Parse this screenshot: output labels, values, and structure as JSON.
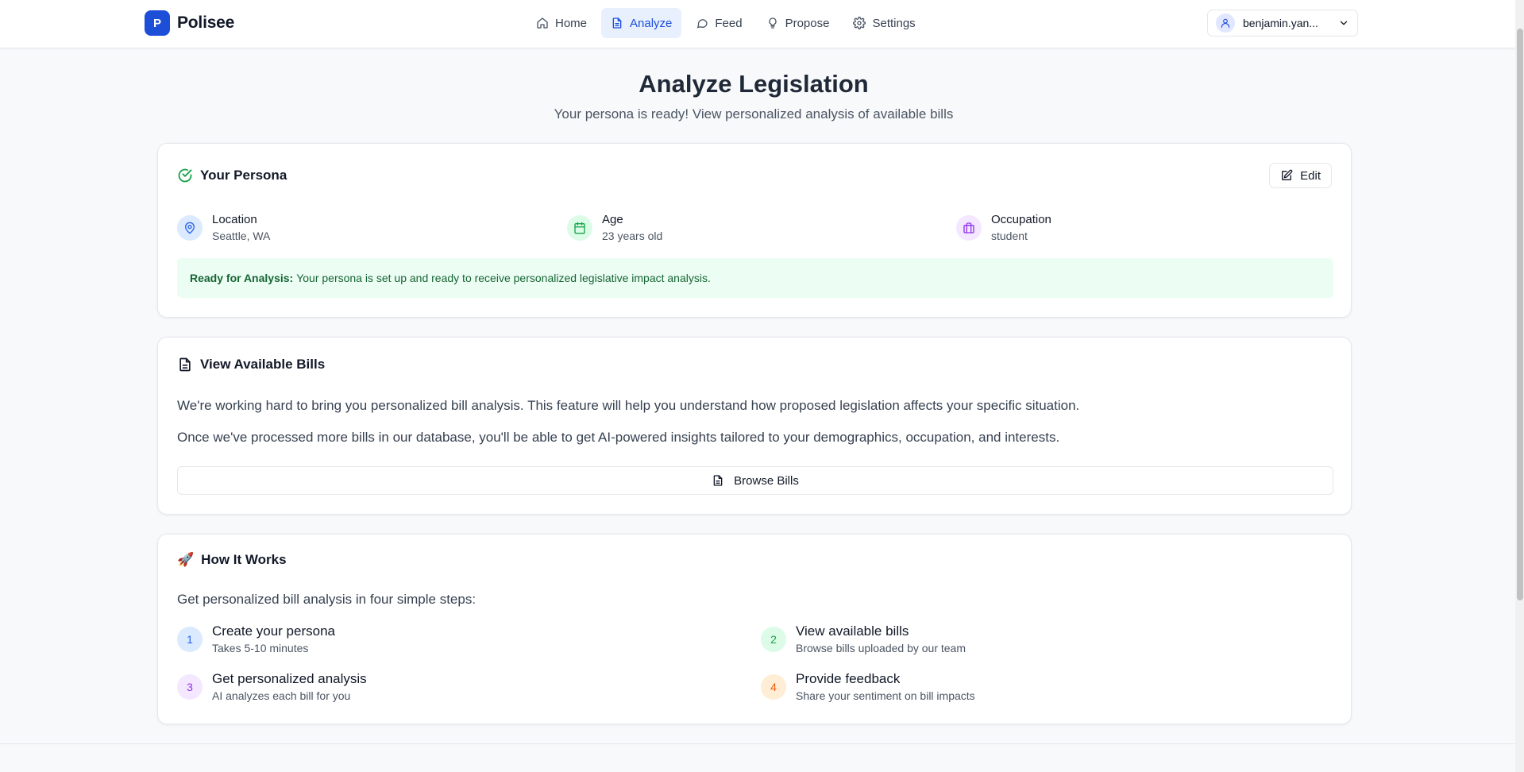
{
  "header": {
    "brand_initial": "P",
    "brand_name": "Polisee",
    "nav": [
      {
        "label": "Home",
        "icon": "home-icon"
      },
      {
        "label": "Analyze",
        "icon": "document-icon",
        "active": true
      },
      {
        "label": "Feed",
        "icon": "message-icon"
      },
      {
        "label": "Propose",
        "icon": "lightbulb-icon"
      },
      {
        "label": "Settings",
        "icon": "gear-icon"
      }
    ],
    "user": {
      "name": "benjamin.yan...",
      "icon": "user-icon"
    }
  },
  "hero": {
    "title": "Analyze Legislation",
    "subtitle": "Your persona is ready! View personalized analysis of available bills"
  },
  "persona": {
    "title": "Your Persona",
    "edit_label": "Edit",
    "fields": [
      {
        "label": "Location",
        "value": "Seattle, WA",
        "icon": "map-pin-icon"
      },
      {
        "label": "Age",
        "value": "23 years old",
        "icon": "calendar-icon"
      },
      {
        "label": "Occupation",
        "value": "student",
        "icon": "briefcase-icon"
      }
    ],
    "ready_label": "Ready for Analysis:",
    "ready_text": "Your persona is set up and ready to receive personalized legislative impact analysis."
  },
  "bills": {
    "title": "View Available Bills",
    "paragraph1": "We're working hard to bring you personalized bill analysis. This feature will help you understand how proposed legislation affects your specific situation.",
    "paragraph2": "Once we've processed more bills in our database, you'll be able to get AI-powered insights tailored to your demographics, occupation, and interests.",
    "browse_label": "Browse Bills"
  },
  "how": {
    "emoji": "🚀",
    "title": "How It Works",
    "intro": "Get personalized bill analysis in four simple steps:",
    "steps": [
      {
        "num": "1",
        "title": "Create your persona",
        "desc": "Takes 5-10 minutes"
      },
      {
        "num": "2",
        "title": "View available bills",
        "desc": "Browse bills uploaded by our team"
      },
      {
        "num": "3",
        "title": "Get personalized analysis",
        "desc": "AI analyzes each bill for you"
      },
      {
        "num": "4",
        "title": "Provide feedback",
        "desc": "Share your sentiment on bill impacts"
      }
    ]
  },
  "colors": {
    "accent": "#1d4ed8",
    "success": "#16a34a",
    "ready_bg": "#ecfdf3"
  }
}
